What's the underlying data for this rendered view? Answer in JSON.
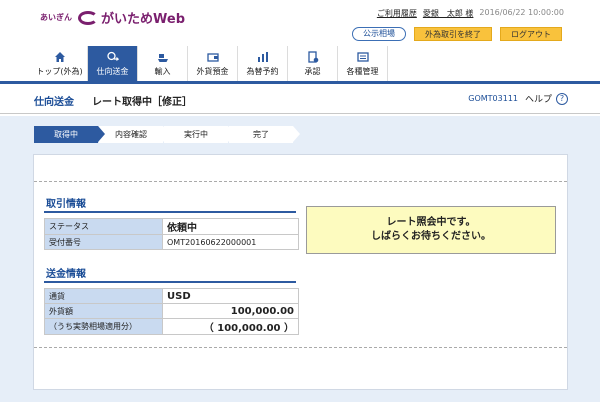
{
  "header": {
    "logo_small": "あいぎん",
    "logo_main": "がいためWeb",
    "history_link": "ご利用履歴",
    "user_name": "愛銀　太郎 様",
    "datetime": "2016/06/22 10:00:00",
    "btn_public_rate": "公示相場",
    "btn_end_trading": "外為取引を終了",
    "btn_logout": "ログアウト"
  },
  "nav": {
    "items": [
      {
        "label": "トップ(外為)",
        "icon": "home-icon"
      },
      {
        "label": "仕向送金",
        "icon": "transfer-icon"
      },
      {
        "label": "輸入",
        "icon": "ship-icon"
      },
      {
        "label": "外貨預金",
        "icon": "wallet-icon"
      },
      {
        "label": "為替予約",
        "icon": "chart-icon"
      },
      {
        "label": "承認",
        "icon": "approval-icon"
      },
      {
        "label": "各種管理",
        "icon": "management-icon"
      }
    ]
  },
  "titlebar": {
    "category": "仕向送金",
    "title": "レート取得中［修正］",
    "screen_id": "GOMT03111",
    "help": "ヘルプ"
  },
  "steps": [
    "取得中",
    "内容確認",
    "実行中",
    "完了"
  ],
  "trade_info": {
    "title": "取引情報",
    "rows": [
      {
        "label": "ステータス",
        "value": "依頼中"
      },
      {
        "label": "受付番号",
        "value": "OMT20160622000001"
      }
    ]
  },
  "remit_info": {
    "title": "送金情報",
    "rows": [
      {
        "label": "通貨",
        "value": "USD"
      },
      {
        "label": "外貨額",
        "value": "100,000.00"
      },
      {
        "label": "（うち実勢相場適用分）",
        "value": "（ 100,000.00 ）"
      }
    ]
  },
  "notice": {
    "line1": "レート照会中です。",
    "line2": "しばらくお待ちください。"
  },
  "colors": {
    "brand": "#7a1f6e",
    "primary": "#2d5aa0",
    "notice_bg": "#fdfbbf",
    "label_bg": "#c9daf0",
    "button_yellow": "#f9c23c"
  }
}
